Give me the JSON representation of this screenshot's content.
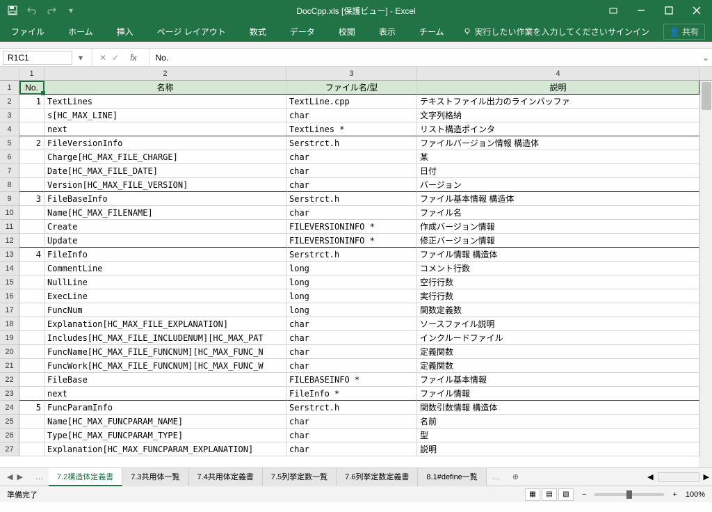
{
  "title": "DocCpp.xls [保護ビュー] - Excel",
  "qat": {
    "save": "保存",
    "undo": "元に戻す",
    "redo": "やり直し"
  },
  "ribbon": {
    "tabs": [
      "ファイル",
      "ホーム",
      "挿入",
      "ページ レイアウト",
      "数式",
      "データ",
      "校閲",
      "表示",
      "チーム"
    ],
    "tellme": "実行したい作業を入力してください",
    "signin": "サインイン",
    "share": "共有"
  },
  "namebox": "R1C1",
  "formula": "No.",
  "col_headers": [
    "1",
    "2",
    "3",
    "4"
  ],
  "table_header": {
    "no": "No.",
    "name": "名称",
    "file": "ファイル名/型",
    "desc": "説明"
  },
  "rows": [
    {
      "rn": "2",
      "no": "1",
      "name": "TextLines",
      "file": "TextLine.cpp",
      "desc": "テキストファイル出力のラインバッファ"
    },
    {
      "rn": "3",
      "no": "",
      "name": "s[HC_MAX_LINE]",
      "file": "char",
      "desc": "文字列格納"
    },
    {
      "rn": "4",
      "no": "",
      "name": "next",
      "file": "TextLines *",
      "desc": "リスト構造ポインタ",
      "end": true
    },
    {
      "rn": "5",
      "no": "2",
      "name": "FileVersionInfo",
      "file": "Serstrct.h",
      "desc": "ファイルバージョン情報 構造体"
    },
    {
      "rn": "6",
      "no": "",
      "name": "Charge[HC_MAX_FILE_CHARGE]",
      "file": "char",
      "desc": "某"
    },
    {
      "rn": "7",
      "no": "",
      "name": "Date[HC_MAX_FILE_DATE]",
      "file": "char",
      "desc": "日付"
    },
    {
      "rn": "8",
      "no": "",
      "name": "Version[HC_MAX_FILE_VERSION]",
      "file": "char",
      "desc": "バージョン",
      "end": true
    },
    {
      "rn": "9",
      "no": "3",
      "name": "FileBaseInfo",
      "file": "Serstrct.h",
      "desc": "ファイル基本情報 構造体"
    },
    {
      "rn": "10",
      "no": "",
      "name": "Name[HC_MAX_FILENAME]",
      "file": "char",
      "desc": "ファイル名"
    },
    {
      "rn": "11",
      "no": "",
      "name": "Create",
      "file": "FILEVERSIONINFO *",
      "desc": "作成バージョン情報"
    },
    {
      "rn": "12",
      "no": "",
      "name": "Update",
      "file": "FILEVERSIONINFO *",
      "desc": "修正バージョン情報",
      "end": true
    },
    {
      "rn": "13",
      "no": "4",
      "name": "FileInfo",
      "file": "Serstrct.h",
      "desc": "ファイル情報 構造体"
    },
    {
      "rn": "14",
      "no": "",
      "name": "CommentLine",
      "file": "long",
      "desc": "コメント行数"
    },
    {
      "rn": "15",
      "no": "",
      "name": "NullLine",
      "file": "long",
      "desc": "空行行数"
    },
    {
      "rn": "16",
      "no": "",
      "name": "ExecLine",
      "file": "long",
      "desc": "実行行数"
    },
    {
      "rn": "17",
      "no": "",
      "name": "FuncNum",
      "file": "long",
      "desc": "関数定義数"
    },
    {
      "rn": "18",
      "no": "",
      "name": "Explanation[HC_MAX_FILE_EXPLANATION]",
      "file": "char",
      "desc": "ソースファイル説明"
    },
    {
      "rn": "19",
      "no": "",
      "name": "Includes[HC_MAX_FILE_INCLUDENUM][HC_MAX_PAT",
      "file": "char",
      "desc": "インクルードファイル"
    },
    {
      "rn": "20",
      "no": "",
      "name": "FuncName[HC_MAX_FILE_FUNCNUM][HC_MAX_FUNC_N",
      "file": "char",
      "desc": "定義関数"
    },
    {
      "rn": "21",
      "no": "",
      "name": "FuncWork[HC_MAX_FILE_FUNCNUM][HC_MAX_FUNC_W",
      "file": "char",
      "desc": "定義関数"
    },
    {
      "rn": "22",
      "no": "",
      "name": "FileBase",
      "file": "FILEBASEINFO *",
      "desc": "ファイル基本情報"
    },
    {
      "rn": "23",
      "no": "",
      "name": "next",
      "file": "FileInfo *",
      "desc": "ファイル情報",
      "end": true
    },
    {
      "rn": "24",
      "no": "5",
      "name": "FuncParamInfo",
      "file": "Serstrct.h",
      "desc": "関数引数情報 構造体"
    },
    {
      "rn": "25",
      "no": "",
      "name": "Name[HC_MAX_FUNCPARAM_NAME]",
      "file": "char",
      "desc": "名前"
    },
    {
      "rn": "26",
      "no": "",
      "name": "Type[HC_MAX_FUNCPARAM_TYPE]",
      "file": "char",
      "desc": "型"
    },
    {
      "rn": "27",
      "no": "",
      "name": "Explanation[HC_MAX_FUNCPARAM_EXPLANATION]",
      "file": "char",
      "desc": "説明"
    }
  ],
  "sheets": {
    "active": "7.2構造体定義書",
    "tabs": [
      "7.2構造体定義書",
      "7.3共用体一覧",
      "7.4共用体定義書",
      "7.5列挙定数一覧",
      "7.6列挙定数定義書",
      "8.1#define一覧"
    ]
  },
  "status": {
    "ready": "準備完了",
    "zoom": "100%"
  }
}
